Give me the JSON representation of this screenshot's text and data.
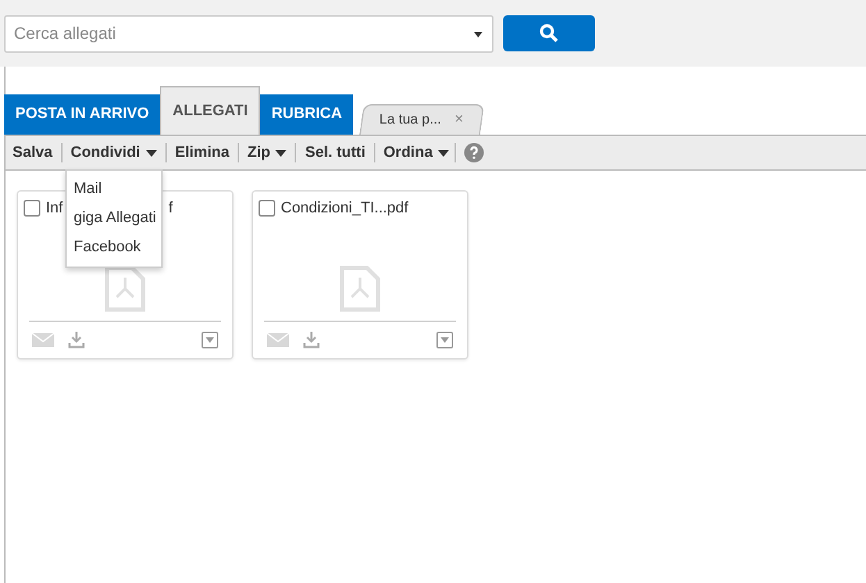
{
  "search": {
    "placeholder": "Cerca allegati"
  },
  "tabs": [
    {
      "label": "POSTA IN ARRIVO",
      "selected": false,
      "kind": "main"
    },
    {
      "label": "ALLEGATI",
      "selected": true,
      "kind": "main"
    },
    {
      "label": "RUBRICA",
      "selected": false,
      "kind": "main"
    },
    {
      "label": "La tua p...",
      "selected": false,
      "kind": "closable",
      "close": "×"
    }
  ],
  "toolbar": [
    {
      "label": "Salva",
      "dropdown": false
    },
    {
      "label": "Condividi",
      "dropdown": true
    },
    {
      "label": "Elimina",
      "dropdown": false
    },
    {
      "label": "Zip",
      "dropdown": true
    },
    {
      "label": "Sel. tutti",
      "dropdown": false
    },
    {
      "label": "Ordina",
      "dropdown": true
    }
  ],
  "share_menu": [
    "Mail",
    "giga Allegati",
    "Facebook"
  ],
  "files": [
    {
      "name_parts": [
        "Inf",
        "f"
      ],
      "checked": false
    },
    {
      "name_parts": [
        "Condizioni_TI...pdf"
      ],
      "checked": false
    }
  ]
}
